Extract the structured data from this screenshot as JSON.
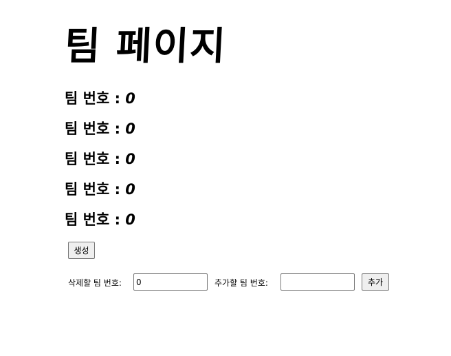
{
  "page": {
    "title": "팀 페이지"
  },
  "teams": [
    {
      "label": "팀 번호 : ",
      "value": "0"
    },
    {
      "label": "팀 번호 : ",
      "value": "0"
    },
    {
      "label": "팀 번호 : ",
      "value": "0"
    },
    {
      "label": "팀 번호 : ",
      "value": "0"
    },
    {
      "label": "팀 번호 : ",
      "value": "0"
    }
  ],
  "controls": {
    "create_label": "생성",
    "delete_label": "삭제할 팀 번호:",
    "delete_value": "0",
    "add_label": "추가할 팀 번호:",
    "add_value": "",
    "add_button_label": "추가"
  }
}
